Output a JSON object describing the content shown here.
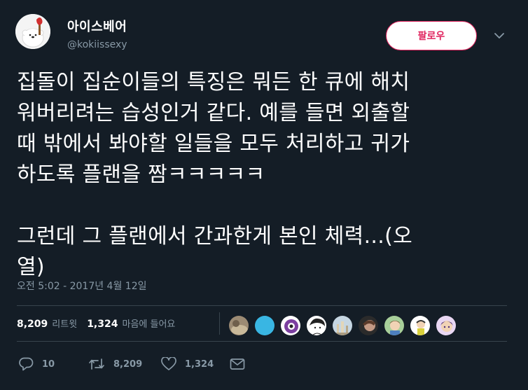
{
  "author": {
    "display_name": "아이스베어",
    "handle": "@kokiissexy"
  },
  "follow_label": "팔로우",
  "tweet": {
    "text": "집돌이 집순이들의 특징은 뭐든 한 큐에 해치\n워버리려는 습성인거 같다. 예를 들면 외출할\n때 밖에서 봐야할 일들을 모두 처리하고 귀가\n하도록 플랜을 짬ㅋㅋㅋㅋㅋ\n\n그런데 그 플랜에서 간과한게 본인 체력...(오\n열)",
    "timestamp": "오전 5:02 - 2017년 4월 12일"
  },
  "stats": {
    "retweets_count": "8,209",
    "retweets_label": "리트윗",
    "likes_count": "1,324",
    "likes_label": "마음에 들어요"
  },
  "actions": {
    "reply_count": "10",
    "retweet_count": "8,209",
    "like_count": "1,324"
  },
  "colors": {
    "background": "#141d26",
    "text": "#ffffff",
    "muted": "#8899a6",
    "follow_accent": "#e0245e",
    "divider": "#38444d"
  },
  "icons": [
    "bear-avatar",
    "chevron-down-icon",
    "reply-icon",
    "retweet-icon",
    "heart-icon",
    "mail-icon"
  ]
}
